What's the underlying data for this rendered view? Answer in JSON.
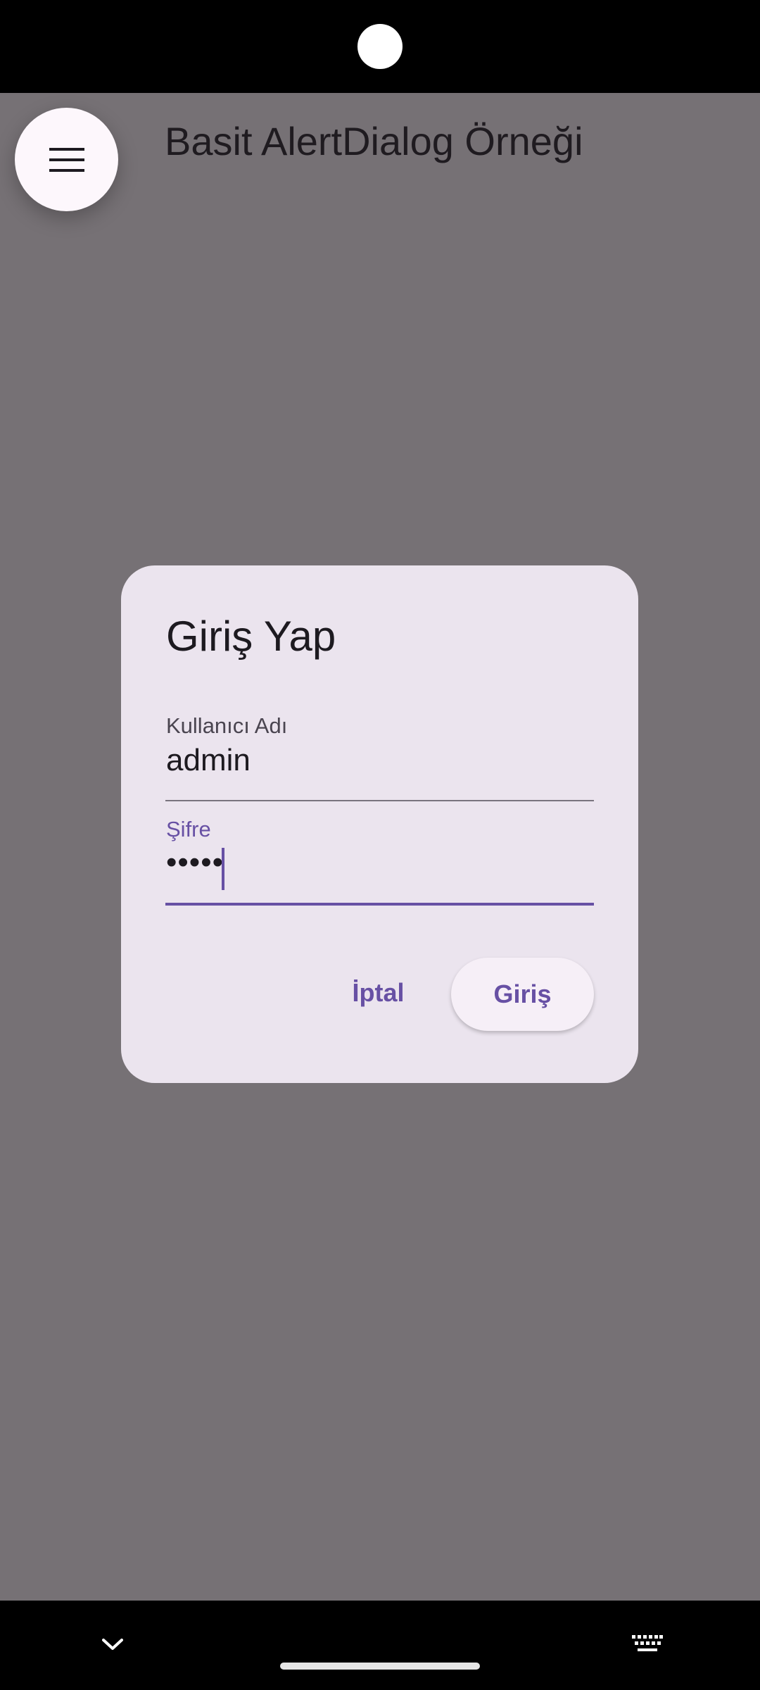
{
  "app_bar": {
    "title": "Basit AlertDialog Örneği",
    "menu_icon": "menu-icon"
  },
  "dialog": {
    "title": "Giriş Yap",
    "username": {
      "label": "Kullanıcı Adı",
      "value": "admin"
    },
    "password": {
      "label": "Şifre",
      "value": "•••••"
    },
    "cancel_label": "İptal",
    "login_label": "Giriş"
  },
  "system_nav": {
    "left_icon": "chevron-down-icon",
    "right_icon": "keyboard-icon"
  },
  "colors": {
    "scrim_background": "#767175",
    "dialog_background": "#ebe4ee",
    "accent": "#6750a4",
    "text": "#1d1a20"
  }
}
